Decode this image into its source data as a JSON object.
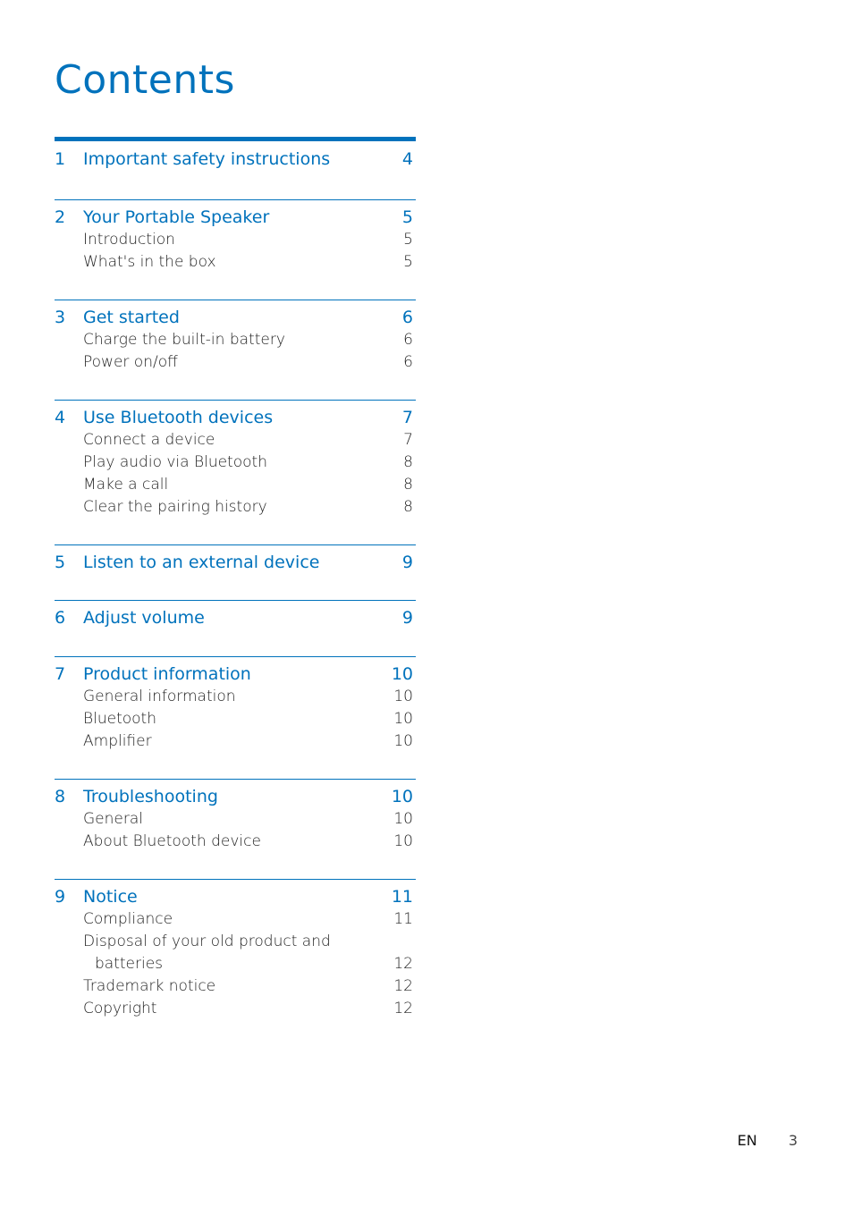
{
  "page_title": "Contents",
  "accent_color": "#0072BC",
  "sections": [
    {
      "num": "1",
      "title": "Important safety instructions",
      "page": "4",
      "items": []
    },
    {
      "num": "2",
      "title": "Your Portable Speaker",
      "page": "5",
      "items": [
        {
          "label": "Introduction",
          "page": "5"
        },
        {
          "label": "What's in the box",
          "page": "5"
        }
      ]
    },
    {
      "num": "3",
      "title": "Get started",
      "page": "6",
      "items": [
        {
          "label": "Charge the built-in battery",
          "page": "6"
        },
        {
          "label": "Power on/off",
          "page": "6"
        }
      ]
    },
    {
      "num": "4",
      "title": "Use Bluetooth devices",
      "page": "7",
      "items": [
        {
          "label": "Connect a device",
          "page": "7"
        },
        {
          "label": "Play audio via Bluetooth",
          "page": "8"
        },
        {
          "label": "Make a call",
          "page": "8"
        },
        {
          "label": "Clear the pairing history",
          "page": "8"
        }
      ]
    },
    {
      "num": "5",
      "title": "Listen to an external device",
      "page": "9",
      "items": []
    },
    {
      "num": "6",
      "title": "Adjust volume",
      "page": "9",
      "items": []
    },
    {
      "num": "7",
      "title": "Product information",
      "page": "10",
      "items": [
        {
          "label": "General information",
          "page": "10"
        },
        {
          "label": "Bluetooth",
          "page": "10"
        },
        {
          "label": "Amplifier",
          "page": "10"
        }
      ]
    },
    {
      "num": "8",
      "title": "Troubleshooting",
      "page": "10",
      "items": [
        {
          "label": "General",
          "page": "10"
        },
        {
          "label": "About Bluetooth device",
          "page": "10"
        }
      ]
    },
    {
      "num": "9",
      "title": "Notice",
      "page": "11",
      "items": [
        {
          "label": "Compliance",
          "page": "11"
        },
        {
          "label": "Disposal of your old product and",
          "page": ""
        },
        {
          "label": "batteries",
          "page": "12",
          "continuation": true
        },
        {
          "label": "Trademark notice",
          "page": "12"
        },
        {
          "label": "Copyright",
          "page": "12"
        }
      ]
    }
  ],
  "footer": {
    "language": "EN",
    "page_number": "3"
  }
}
